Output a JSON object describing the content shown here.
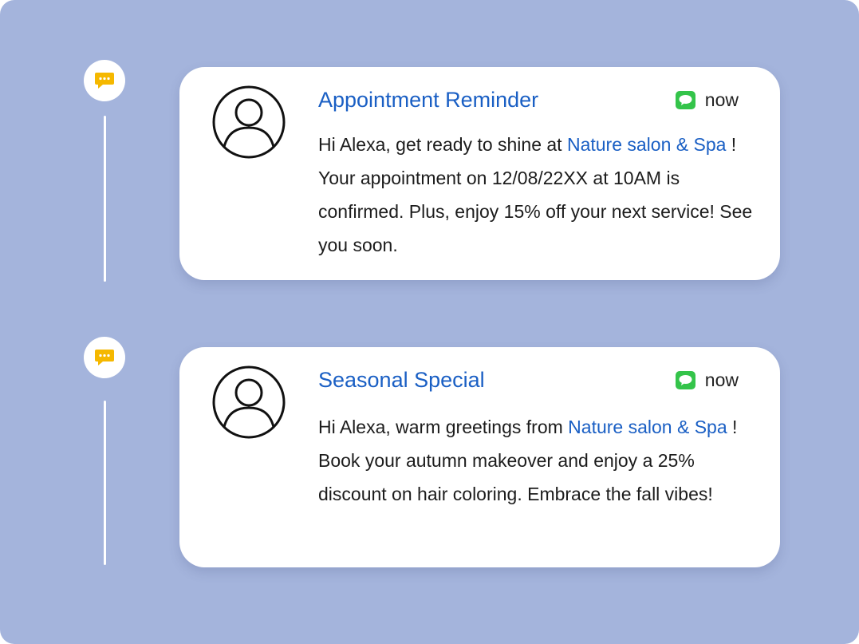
{
  "notifications": [
    {
      "title": "Appointment Reminder",
      "time": "now",
      "greeting": "Hi Alexa, get ready to shine at ",
      "business": "Nature salon & Spa",
      "message": " ! Your appointment on 12/08/22XX at 10AM is confirmed. Plus, enjoy 15% off your next service! See you soon."
    },
    {
      "title": "Seasonal Special",
      "time": "now",
      "greeting": "Hi Alexa, warm greetings from ",
      "business": "Nature salon & Spa",
      "message": " ! Book your autumn makeover and enjoy a 25% discount on hair coloring. Embrace the fall vibes!"
    }
  ],
  "icons": {
    "timeline_node": "chat-bubble-icon",
    "avatar": "user-avatar-icon",
    "channel": "message-icon"
  },
  "colors": {
    "background": "#a4b4dc",
    "accent": "#1a5fc4",
    "timeline_icon": "#f5b800",
    "channel_icon": "#34c44a"
  }
}
